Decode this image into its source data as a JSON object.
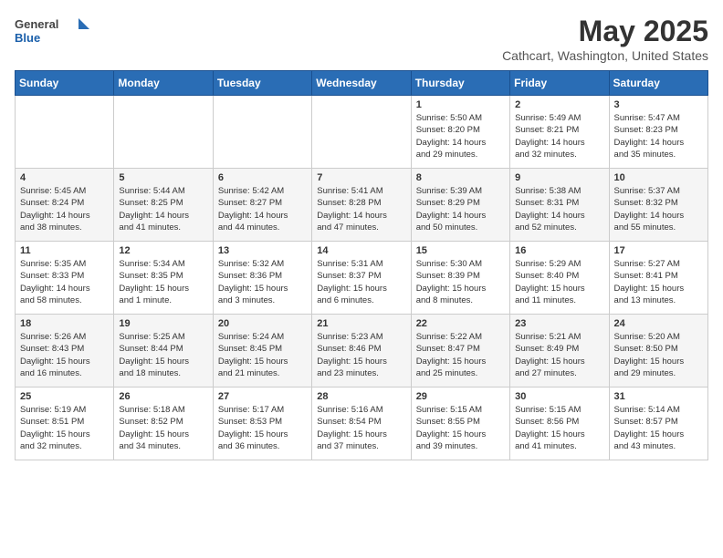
{
  "header": {
    "logo_general": "General",
    "logo_blue": "Blue",
    "month": "May 2025",
    "location": "Cathcart, Washington, United States"
  },
  "weekdays": [
    "Sunday",
    "Monday",
    "Tuesday",
    "Wednesday",
    "Thursday",
    "Friday",
    "Saturday"
  ],
  "weeks": [
    [
      {
        "day": "",
        "info": ""
      },
      {
        "day": "",
        "info": ""
      },
      {
        "day": "",
        "info": ""
      },
      {
        "day": "",
        "info": ""
      },
      {
        "day": "1",
        "info": "Sunrise: 5:50 AM\nSunset: 8:20 PM\nDaylight: 14 hours\nand 29 minutes."
      },
      {
        "day": "2",
        "info": "Sunrise: 5:49 AM\nSunset: 8:21 PM\nDaylight: 14 hours\nand 32 minutes."
      },
      {
        "day": "3",
        "info": "Sunrise: 5:47 AM\nSunset: 8:23 PM\nDaylight: 14 hours\nand 35 minutes."
      }
    ],
    [
      {
        "day": "4",
        "info": "Sunrise: 5:45 AM\nSunset: 8:24 PM\nDaylight: 14 hours\nand 38 minutes."
      },
      {
        "day": "5",
        "info": "Sunrise: 5:44 AM\nSunset: 8:25 PM\nDaylight: 14 hours\nand 41 minutes."
      },
      {
        "day": "6",
        "info": "Sunrise: 5:42 AM\nSunset: 8:27 PM\nDaylight: 14 hours\nand 44 minutes."
      },
      {
        "day": "7",
        "info": "Sunrise: 5:41 AM\nSunset: 8:28 PM\nDaylight: 14 hours\nand 47 minutes."
      },
      {
        "day": "8",
        "info": "Sunrise: 5:39 AM\nSunset: 8:29 PM\nDaylight: 14 hours\nand 50 minutes."
      },
      {
        "day": "9",
        "info": "Sunrise: 5:38 AM\nSunset: 8:31 PM\nDaylight: 14 hours\nand 52 minutes."
      },
      {
        "day": "10",
        "info": "Sunrise: 5:37 AM\nSunset: 8:32 PM\nDaylight: 14 hours\nand 55 minutes."
      }
    ],
    [
      {
        "day": "11",
        "info": "Sunrise: 5:35 AM\nSunset: 8:33 PM\nDaylight: 14 hours\nand 58 minutes."
      },
      {
        "day": "12",
        "info": "Sunrise: 5:34 AM\nSunset: 8:35 PM\nDaylight: 15 hours\nand 1 minute."
      },
      {
        "day": "13",
        "info": "Sunrise: 5:32 AM\nSunset: 8:36 PM\nDaylight: 15 hours\nand 3 minutes."
      },
      {
        "day": "14",
        "info": "Sunrise: 5:31 AM\nSunset: 8:37 PM\nDaylight: 15 hours\nand 6 minutes."
      },
      {
        "day": "15",
        "info": "Sunrise: 5:30 AM\nSunset: 8:39 PM\nDaylight: 15 hours\nand 8 minutes."
      },
      {
        "day": "16",
        "info": "Sunrise: 5:29 AM\nSunset: 8:40 PM\nDaylight: 15 hours\nand 11 minutes."
      },
      {
        "day": "17",
        "info": "Sunrise: 5:27 AM\nSunset: 8:41 PM\nDaylight: 15 hours\nand 13 minutes."
      }
    ],
    [
      {
        "day": "18",
        "info": "Sunrise: 5:26 AM\nSunset: 8:43 PM\nDaylight: 15 hours\nand 16 minutes."
      },
      {
        "day": "19",
        "info": "Sunrise: 5:25 AM\nSunset: 8:44 PM\nDaylight: 15 hours\nand 18 minutes."
      },
      {
        "day": "20",
        "info": "Sunrise: 5:24 AM\nSunset: 8:45 PM\nDaylight: 15 hours\nand 21 minutes."
      },
      {
        "day": "21",
        "info": "Sunrise: 5:23 AM\nSunset: 8:46 PM\nDaylight: 15 hours\nand 23 minutes."
      },
      {
        "day": "22",
        "info": "Sunrise: 5:22 AM\nSunset: 8:47 PM\nDaylight: 15 hours\nand 25 minutes."
      },
      {
        "day": "23",
        "info": "Sunrise: 5:21 AM\nSunset: 8:49 PM\nDaylight: 15 hours\nand 27 minutes."
      },
      {
        "day": "24",
        "info": "Sunrise: 5:20 AM\nSunset: 8:50 PM\nDaylight: 15 hours\nand 29 minutes."
      }
    ],
    [
      {
        "day": "25",
        "info": "Sunrise: 5:19 AM\nSunset: 8:51 PM\nDaylight: 15 hours\nand 32 minutes."
      },
      {
        "day": "26",
        "info": "Sunrise: 5:18 AM\nSunset: 8:52 PM\nDaylight: 15 hours\nand 34 minutes."
      },
      {
        "day": "27",
        "info": "Sunrise: 5:17 AM\nSunset: 8:53 PM\nDaylight: 15 hours\nand 36 minutes."
      },
      {
        "day": "28",
        "info": "Sunrise: 5:16 AM\nSunset: 8:54 PM\nDaylight: 15 hours\nand 37 minutes."
      },
      {
        "day": "29",
        "info": "Sunrise: 5:15 AM\nSunset: 8:55 PM\nDaylight: 15 hours\nand 39 minutes."
      },
      {
        "day": "30",
        "info": "Sunrise: 5:15 AM\nSunset: 8:56 PM\nDaylight: 15 hours\nand 41 minutes."
      },
      {
        "day": "31",
        "info": "Sunrise: 5:14 AM\nSunset: 8:57 PM\nDaylight: 15 hours\nand 43 minutes."
      }
    ]
  ]
}
